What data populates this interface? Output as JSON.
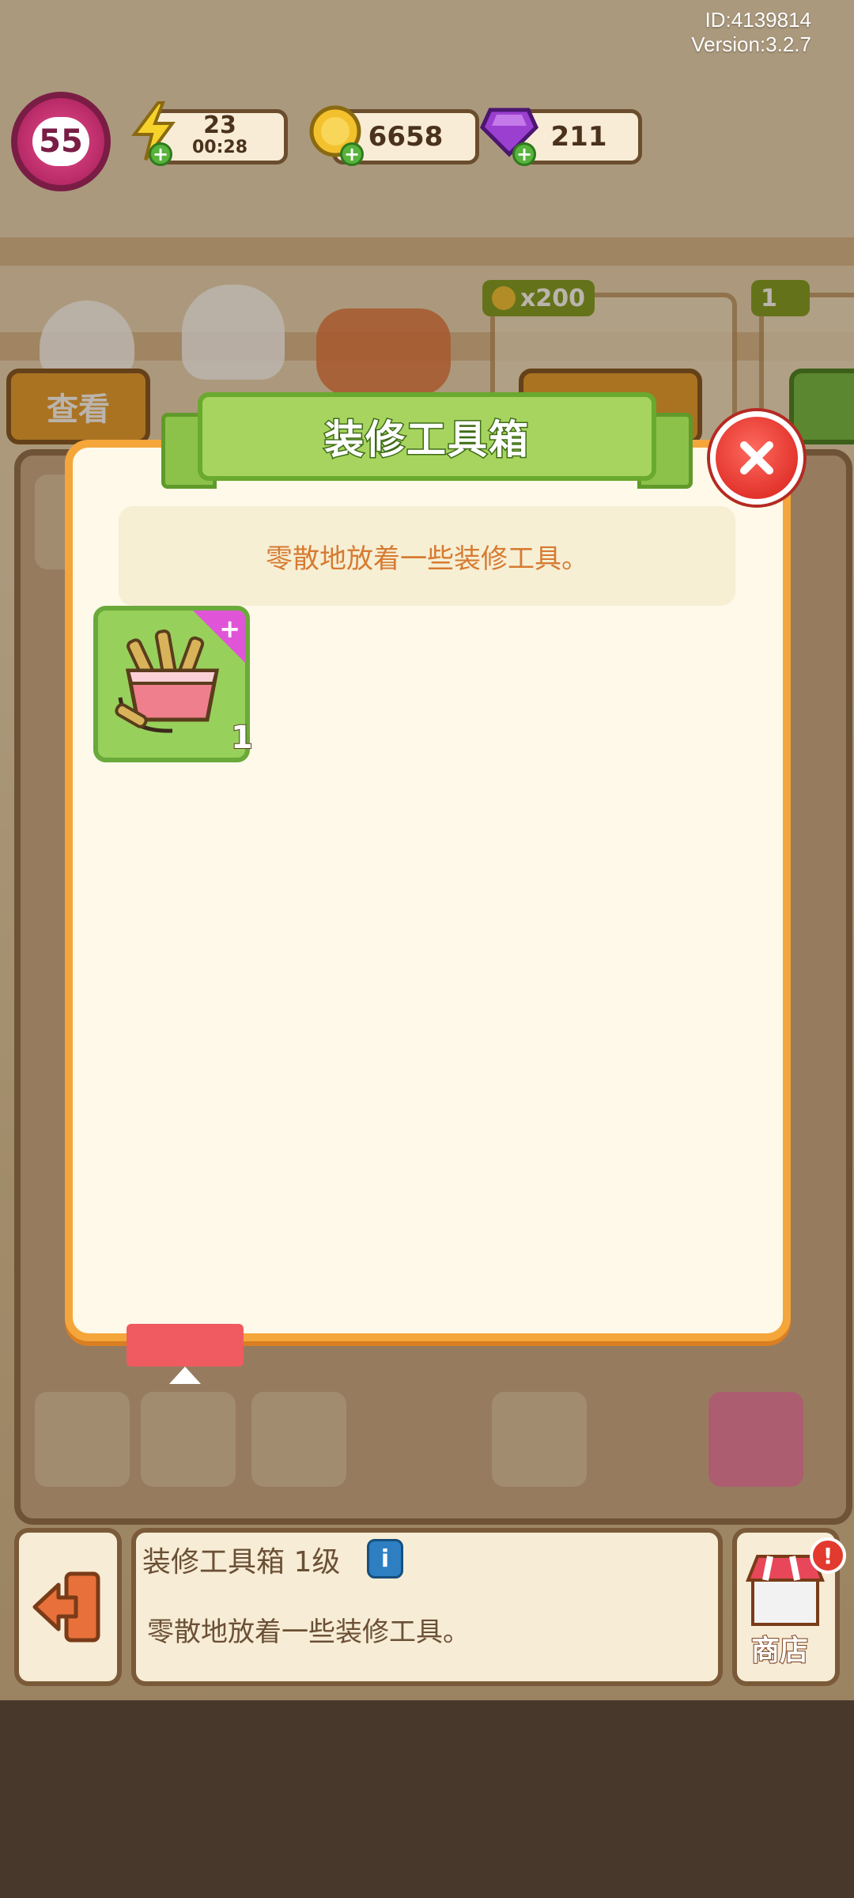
{
  "header": {
    "id_text": "ID:4139814",
    "version_text": "Version:3.2.7"
  },
  "hud": {
    "level": "55",
    "energy": {
      "value": "23",
      "timer": "00:28"
    },
    "coins": "6658",
    "gems": "211"
  },
  "background": {
    "view_button": "查看",
    "price_tag": "x200",
    "star_count": "1"
  },
  "modal": {
    "title": "装修工具箱",
    "description": "零散地放着一些装修工具。",
    "items": [
      {
        "name": "toolbox-item",
        "count": "1"
      }
    ]
  },
  "bottom_bar": {
    "item_title": "装修工具箱 1级",
    "info_badge": "i",
    "item_description": "零散地放着一些装修工具。",
    "shop_label": "商店"
  },
  "colors": {
    "modal_border": "#f4a63b",
    "banner_green": "#a6d45e",
    "close_red": "#e2342d",
    "description_text": "#d77b32",
    "item_card_green": "#98d05c"
  }
}
